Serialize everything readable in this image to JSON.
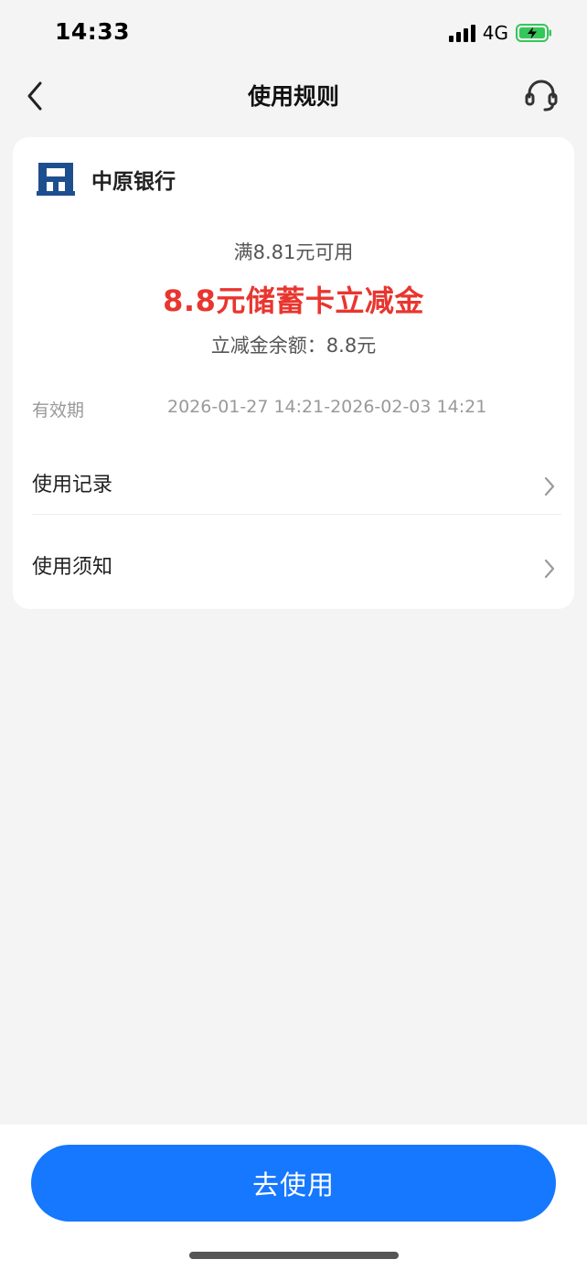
{
  "status_bar": {
    "time": "14:33",
    "network": "4G",
    "battery_color": "#34c759",
    "icons": [
      "signal-icon",
      "battery-charging-icon"
    ]
  },
  "nav": {
    "title": "使用规则",
    "back_icon": "chevron-left-icon",
    "service_icon": "headset-icon"
  },
  "card": {
    "bank_name": "中原银行",
    "bank_logo_color": "#1d4f8f",
    "condition": "满8.81元可用",
    "coupon_title": "8.8元储蓄卡立减金",
    "coupon_title_color": "#e8362f",
    "balance": "立减金余额：8.8元",
    "validity_label": "有效期",
    "validity_value": "2026-01-27 14:21-2026-02-03 14:21",
    "menu_items": [
      {
        "label": "使用记录",
        "icon": "chevron-right-icon"
      },
      {
        "label": "使用须知",
        "icon": "chevron-right-icon"
      }
    ]
  },
  "bottom": {
    "use_button": "去使用",
    "button_color": "#1677ff"
  }
}
